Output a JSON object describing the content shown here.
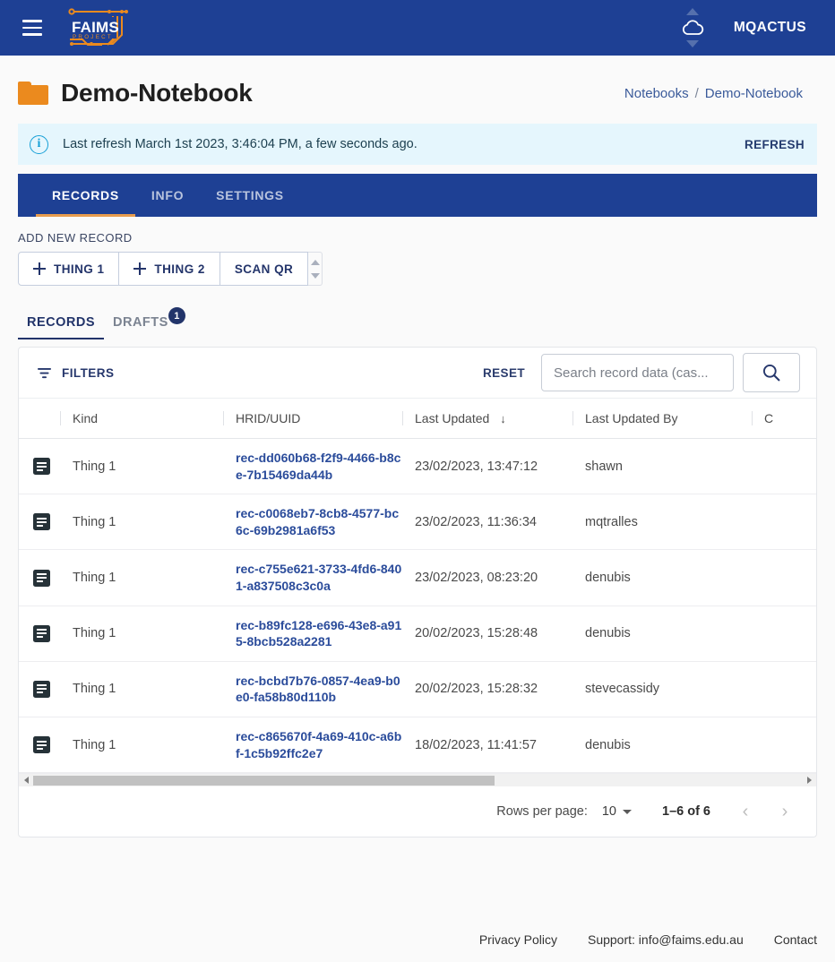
{
  "appbar": {
    "menu_icon": "hamburger-icon",
    "logo_text_primary": "FAIMS",
    "logo_text_secondary": "PROJECT",
    "sync_icon": "cloud-sync-icon",
    "username": "MQACTUS"
  },
  "header": {
    "folder_icon": "folder-icon",
    "title": "Demo-Notebook",
    "breadcrumb": {
      "root": "Notebooks",
      "separator": "/",
      "current": "Demo-Notebook"
    }
  },
  "alert": {
    "icon": "info-icon",
    "message": "Last refresh March 1st 2023, 3:46:04 PM, a few seconds ago.",
    "action_label": "REFRESH",
    "background": "#e5f6fd",
    "accent": "#159fd6"
  },
  "notebook_tabs": {
    "active": "RECORDS",
    "items": [
      {
        "label": "RECORDS"
      },
      {
        "label": "INFO"
      },
      {
        "label": "SETTINGS"
      }
    ],
    "bar_color": "#1e4094",
    "indicator_color": "#e79c4e"
  },
  "add_new_record": {
    "label": "ADD NEW RECORD",
    "buttons": [
      {
        "label": "THING 1",
        "icon": "plus-icon"
      },
      {
        "label": "THING 2",
        "icon": "plus-icon"
      },
      {
        "label": "SCAN QR",
        "icon": ""
      }
    ],
    "stepper_icon": "up-down-stepper-icon"
  },
  "record_tabs": {
    "active": "RECORDS",
    "items": [
      {
        "label": "RECORDS",
        "badge": ""
      },
      {
        "label": "DRAFTS",
        "badge": "1"
      }
    ]
  },
  "toolbar": {
    "filters_label": "FILTERS",
    "filters_icon": "filter-icon",
    "reset_label": "RESET",
    "search_placeholder": "Search record data (cas...",
    "search_value": "",
    "search_icon": "search-icon"
  },
  "table": {
    "columns": [
      {
        "key": "icon",
        "label": ""
      },
      {
        "key": "kind",
        "label": "Kind"
      },
      {
        "key": "hrid",
        "label": "HRID/UUID"
      },
      {
        "key": "updated",
        "label": "Last Updated",
        "sort": "desc",
        "sort_glyph": "↓"
      },
      {
        "key": "updated_by",
        "label": "Last Updated By"
      },
      {
        "key": "created",
        "label": "C"
      }
    ],
    "rows": [
      {
        "icon": "record-icon",
        "kind": "Thing 1",
        "hrid": "rec-dd060b68-f2f9-4466-b8ce-7b15469da44b",
        "updated": "23/02/2023, 13:47:12",
        "updated_by": "shawn"
      },
      {
        "icon": "record-icon",
        "kind": "Thing 1",
        "hrid": "rec-c0068eb7-8cb8-4577-bc6c-69b2981a6f53",
        "updated": "23/02/2023, 11:36:34",
        "updated_by": "mqtralles"
      },
      {
        "icon": "record-icon",
        "kind": "Thing 1",
        "hrid": "rec-c755e621-3733-4fd6-8401-a837508c3c0a",
        "updated": "23/02/2023, 08:23:20",
        "updated_by": "denubis"
      },
      {
        "icon": "record-icon",
        "kind": "Thing 1",
        "hrid": "rec-b89fc128-e696-43e8-a915-8bcb528a2281",
        "updated": "20/02/2023, 15:28:48",
        "updated_by": "denubis"
      },
      {
        "icon": "record-icon",
        "kind": "Thing 1",
        "hrid": "rec-bcbd7b76-0857-4ea9-b0e0-fa58b80d110b",
        "updated": "20/02/2023, 15:28:32",
        "updated_by": "stevecassidy"
      },
      {
        "icon": "record-icon",
        "kind": "Thing 1",
        "hrid": "rec-c865670f-4a69-410c-a6bf-1c5b92ffc2e7",
        "updated": "18/02/2023, 11:41:57",
        "updated_by": "denubis"
      }
    ]
  },
  "pagination": {
    "rows_per_page_label": "Rows per page:",
    "rows_per_page_value": "10",
    "range_label": "1–6 of 6",
    "prev_glyph": "‹",
    "next_glyph": "›"
  },
  "footer": {
    "links": [
      {
        "label": "Privacy Policy"
      },
      {
        "label": "Support: info@faims.edu.au"
      },
      {
        "label": "Contact"
      }
    ]
  },
  "colors": {
    "brand_blue": "#1e4094",
    "brand_orange": "#eb8a1e",
    "link_blue": "#2b4c9b",
    "page_background": "#fafafa"
  }
}
